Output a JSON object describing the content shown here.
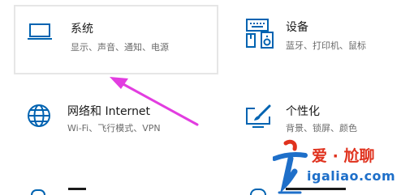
{
  "tiles": {
    "system": {
      "title": "系统",
      "subtitle": "显示、声音、通知、电源",
      "icon": "laptop-icon"
    },
    "devices": {
      "title": "设备",
      "subtitle": "蓝牙、打印机、鼠标",
      "icon": "devices-icon"
    },
    "network": {
      "title": "网络和 Internet",
      "subtitle": "Wi-Fi、飞行模式、VPN",
      "icon": "globe-icon"
    },
    "personalization": {
      "title": "个性化",
      "subtitle": "背景、锁屏、颜色",
      "icon": "paint-brush-icon"
    }
  },
  "colors": {
    "accent": "#0063b1",
    "arrow": "#e23de0",
    "watermark_red": "#e0321e",
    "watermark_blue": "#1e6fc9"
  },
  "watermark": {
    "top": "爱 · 尬聊",
    "bottom": "igaliao.com"
  }
}
